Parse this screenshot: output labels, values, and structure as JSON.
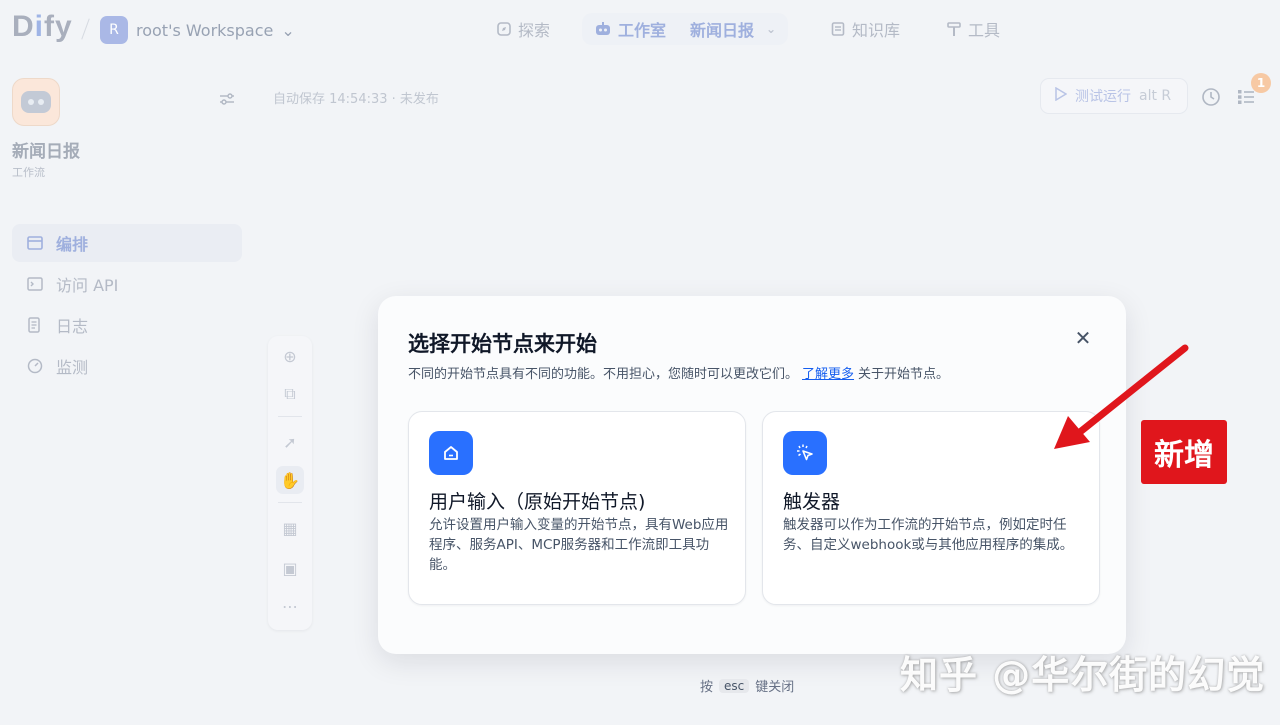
{
  "header": {
    "logo": {
      "d": "D",
      "i": "i",
      "fy": "fy"
    },
    "workspace": {
      "avatar": "R",
      "name": "root's Workspace"
    },
    "nav": {
      "explore": "探索",
      "studio": "工作室",
      "current_app": "新闻日报",
      "knowledge": "知识库",
      "tools": "工具"
    }
  },
  "sidebar": {
    "app_name": "新闻日报",
    "app_type": "工作流",
    "items": [
      {
        "label": "编排",
        "icon": "layout-icon",
        "active": true
      },
      {
        "label": "访问 API",
        "icon": "terminal-icon",
        "active": false
      },
      {
        "label": "日志",
        "icon": "file-list-icon",
        "active": false
      },
      {
        "label": "监测",
        "icon": "gauge-icon",
        "active": false
      }
    ]
  },
  "canvas": {
    "autosave": "自动保存 14:54:33 · 未发布",
    "test_run": {
      "label": "测试运行",
      "shortcut": "alt R"
    },
    "checklist_badge": "1"
  },
  "modal": {
    "title": "选择开始节点来开始",
    "desc_before": "不同的开始节点具有不同的功能。不用担心，您随时可以更改它们。",
    "learn_more": "了解更多",
    "desc_after": "关于开始节点。",
    "cards": [
      {
        "title": "用户输入（原始开始节点)",
        "desc": "允许设置用户输入变量的开始节点，具有Web应用程序、服务API、MCP服务器和工作流即工具功能。",
        "icon": "home-icon"
      },
      {
        "title": "触发器",
        "desc": "触发器可以作为工作流的开始节点，例如定时任务、自定义webhook或与其他应用程序的集成。",
        "icon": "cursor-click-icon"
      }
    ],
    "esc_hint": {
      "before": "按",
      "key": "esc",
      "after": "键关闭"
    }
  },
  "annotations": {
    "new_tag": "新增",
    "arrow_color": "#e0161c",
    "watermark": "知乎 @华尔街的幻觉"
  },
  "colors": {
    "accent": "#2970ff",
    "background": "#f2f4f7",
    "annotation_red": "#e0161c"
  }
}
